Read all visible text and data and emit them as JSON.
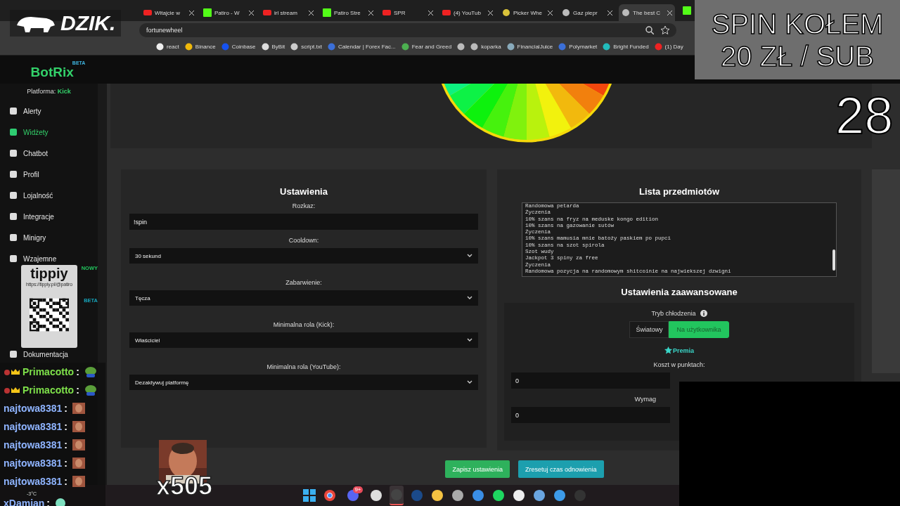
{
  "browser": {
    "tabs": [
      {
        "title": "Witajcie w",
        "selected": false
      },
      {
        "title": "Patiro - W",
        "selected": false
      },
      {
        "title": "irl stream",
        "selected": false
      },
      {
        "title": "Patiro Stre",
        "selected": false
      },
      {
        "title": "SPR",
        "selected": false
      },
      {
        "title": "(4) YouTub",
        "selected": false
      },
      {
        "title": "Picker Whe",
        "selected": false
      },
      {
        "title": "Gaz piepr",
        "selected": false
      },
      {
        "title": "The best C",
        "selected": true
      }
    ],
    "url": "fortunewheel",
    "bookmarks": [
      {
        "label": "react"
      },
      {
        "label": "Binance"
      },
      {
        "label": "Coinbase"
      },
      {
        "label": "ByBit"
      },
      {
        "label": "script.txt"
      },
      {
        "label": "Calendar | Forex Fac..."
      },
      {
        "label": "Fear and Greed"
      },
      {
        "kind": "icon-only"
      },
      {
        "label": "koparka"
      },
      {
        "label": "FinancialJuice"
      },
      {
        "label": "Polymarket"
      },
      {
        "label": "Bright Funded"
      },
      {
        "label": "(1) Day"
      }
    ]
  },
  "app": {
    "logo": "BotRix",
    "logo_badge": "BETA",
    "platform_label": "Platforma:",
    "platform": "Kick",
    "sidebar": [
      {
        "kind": "link",
        "label": "Alerty",
        "selected": false
      },
      {
        "kind": "link",
        "label": "Widżety",
        "selected": true
      },
      {
        "kind": "link",
        "label": "Chatbot",
        "selected": false
      },
      {
        "kind": "link",
        "label": "Profil",
        "selected": false
      },
      {
        "kind": "link",
        "label": "Lojalność",
        "selected": false
      },
      {
        "kind": "link",
        "label": "Integracje",
        "selected": false
      },
      {
        "kind": "link",
        "label": "Minigry",
        "selected": false
      },
      {
        "kind": "link",
        "label": "Wzajemne",
        "selected": false
      },
      {
        "kind": "badge",
        "badge": "NOWY",
        "color": "#22c55e"
      },
      {
        "kind": "badge",
        "badge": "BETA",
        "color": "#17a2b8"
      },
      {
        "kind": "link",
        "label": "Dokumentacja",
        "selected": false
      }
    ],
    "settings": {
      "title": "Ustawienia",
      "fields": [
        {
          "kind": "input",
          "label": "Rozkaz:",
          "value": "!spin"
        },
        {
          "kind": "select",
          "label": "Cooldown:",
          "value": "30 sekund"
        },
        {
          "kind": "select",
          "label": "Zabarwienie:",
          "value": "Tęcza"
        },
        {
          "kind": "select",
          "label": "Minimalna rola (Kick):",
          "value": "Właściciel"
        },
        {
          "kind": "select",
          "label": "Minimalna rola (YouTube):",
          "value": "Dezaktywuj platformę"
        }
      ]
    },
    "items": {
      "title": "Lista przedmiotów",
      "lines": [
        "Randomowa petarda",
        "Życzenia",
        "10% szans na fryz na meduske kongo edition",
        "10% szans na gazowanie sutów",
        "Życzenia",
        "10% szans mamusia mnie batoży paskiem po pupci",
        "10% szans na szot spirola",
        "Szot wudy",
        "Jackpot 3 spiny za free",
        "Życzenia",
        "Randomowa pozycja na randomowym shitcoinie na najwiekszej dzwigni"
      ]
    },
    "advanced": {
      "title": "Ustawienia zaawansowane",
      "cooldown_label": "Tryb chłodzenia",
      "modes": [
        {
          "label": "Światowy",
          "selected": false
        },
        {
          "label": "Na użytkownika",
          "selected": true
        }
      ],
      "premium": "Premia",
      "cost_label": "Koszt w punktach:",
      "cost": "0",
      "required_label": "Wymag",
      "required": "0"
    },
    "buttons": [
      {
        "label": "Zapisz ustawienia",
        "kind": "save"
      },
      {
        "label": "Zresetuj czas odnowienia",
        "kind": "reset"
      }
    ]
  },
  "overlays": {
    "brand": "DZIK.",
    "promo": [
      "SPIN KOŁEM",
      "20 ZŁ / SUB"
    ],
    "counter": "28",
    "tip_logo": "tippiy",
    "tip_url": "https://tippiy.pl/@patiro",
    "combo": "x505",
    "weather": "-3°C",
    "chat": [
      {
        "user": "Primacotto",
        "separator": ":",
        "color": "#7ee04a",
        "badges": true,
        "kind": "frog"
      },
      {
        "user": "Primacotto",
        "separator": ":",
        "color": "#7ee04a",
        "badges": true,
        "kind": "frog"
      },
      {
        "user": "najtowa8381",
        "separator": ":",
        "color": "#8fb4ff",
        "badges": false,
        "kind": "face"
      },
      {
        "user": "najtowa8381",
        "separator": ":",
        "color": "#8fb4ff",
        "badges": false,
        "kind": "face"
      },
      {
        "user": "najtowa8381",
        "separator": ":",
        "color": "#8fb4ff",
        "badges": false,
        "kind": "face"
      },
      {
        "user": "najtowa8381",
        "separator": ":",
        "color": "#8fb4ff",
        "badges": false,
        "kind": "face"
      },
      {
        "user": "najtowa8381",
        "separator": ":",
        "color": "#8fb4ff",
        "badges": false,
        "kind": "face"
      },
      {
        "user": "xDamian",
        "separator": ":",
        "color": "#8fb4ff",
        "badges": false,
        "kind": "blob"
      }
    ]
  },
  "taskbar": [
    {
      "active": false
    },
    {
      "active": false
    },
    {
      "active": false,
      "badge": "9+"
    },
    {
      "active": false
    },
    {
      "active": true
    },
    {
      "active": false
    },
    {
      "active": false
    },
    {
      "active": false
    },
    {
      "active": false
    },
    {
      "active": false
    },
    {
      "active": false
    },
    {
      "active": false
    },
    {
      "active": false
    },
    {
      "active": false
    }
  ]
}
